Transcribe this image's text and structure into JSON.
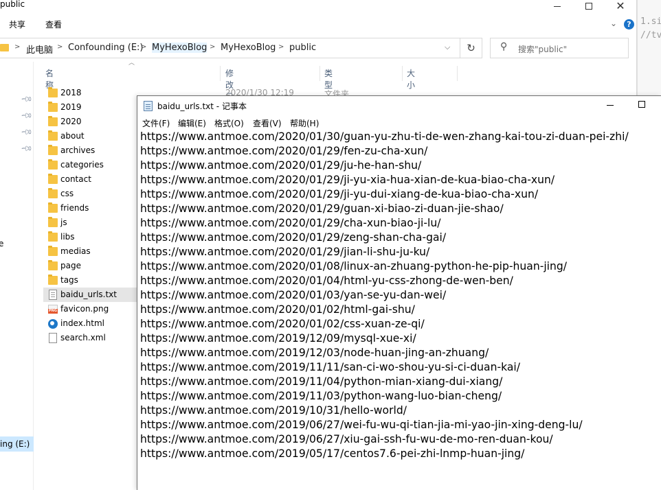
{
  "editor_behind": {
    "line1": "1.si",
    "line2": "//tv"
  },
  "explorer": {
    "title": "public",
    "ribbon": {
      "tab_share": "共享",
      "tab_view": "查看",
      "help_label": "?"
    },
    "breadcrumb": [
      "此电脑",
      "Confounding (E:)",
      "MyHexoBlog",
      "MyHexoBlog",
      "public"
    ],
    "search_placeholder": "搜索\"public\"",
    "columns": {
      "name": "名称",
      "modified": "修改日期",
      "type": "类型",
      "size": "大小"
    },
    "behind_row": {
      "date": "2020/1/30 12:19",
      "type": "文件夹"
    },
    "left_pane": {
      "partial_label": "e",
      "drive_label": "ing (E:)"
    },
    "files": [
      {
        "name": "2018",
        "icon": "folder-icon"
      },
      {
        "name": "2019",
        "icon": "folder-icon"
      },
      {
        "name": "2020",
        "icon": "folder-icon"
      },
      {
        "name": "about",
        "icon": "folder-icon"
      },
      {
        "name": "archives",
        "icon": "folder-icon"
      },
      {
        "name": "categories",
        "icon": "folder-icon"
      },
      {
        "name": "contact",
        "icon": "folder-icon"
      },
      {
        "name": "css",
        "icon": "folder-icon"
      },
      {
        "name": "friends",
        "icon": "folder-icon"
      },
      {
        "name": "js",
        "icon": "folder-icon"
      },
      {
        "name": "libs",
        "icon": "folder-icon"
      },
      {
        "name": "medias",
        "icon": "folder-icon"
      },
      {
        "name": "page",
        "icon": "folder-icon"
      },
      {
        "name": "tags",
        "icon": "folder-icon"
      },
      {
        "name": "baidu_urls.txt",
        "icon": "text-file-icon",
        "selected": true
      },
      {
        "name": "favicon.png",
        "icon": "png-file-icon"
      },
      {
        "name": "index.html",
        "icon": "html-file-icon"
      },
      {
        "name": "search.xml",
        "icon": "xml-file-icon"
      }
    ]
  },
  "notepad": {
    "title": "baidu_urls.txt - 记事本",
    "menu": {
      "file": "文件(F)",
      "edit": "编辑(E)",
      "format": "格式(O)",
      "view": "查看(V)",
      "help": "帮助(H)"
    },
    "lines": [
      "https://www.antmoe.com/2020/01/30/guan-yu-zhu-ti-de-wen-zhang-kai-tou-zi-duan-pei-zhi/",
      "https://www.antmoe.com/2020/01/29/fen-zu-cha-xun/",
      "https://www.antmoe.com/2020/01/29/ju-he-han-shu/",
      "https://www.antmoe.com/2020/01/29/ji-yu-xia-hua-xian-de-kua-biao-cha-xun/",
      "https://www.antmoe.com/2020/01/29/ji-yu-dui-xiang-de-kua-biao-cha-xun/",
      "https://www.antmoe.com/2020/01/29/guan-xi-biao-zi-duan-jie-shao/",
      "https://www.antmoe.com/2020/01/29/cha-xun-biao-ji-lu/",
      "https://www.antmoe.com/2020/01/29/zeng-shan-cha-gai/",
      "https://www.antmoe.com/2020/01/29/jian-li-shu-ju-ku/",
      "https://www.antmoe.com/2020/01/08/linux-an-zhuang-python-he-pip-huan-jing/",
      "https://www.antmoe.com/2020/01/04/html-yu-css-zhong-de-wen-ben/",
      "https://www.antmoe.com/2020/01/03/yan-se-yu-dan-wei/",
      "https://www.antmoe.com/2020/01/02/html-gai-shu/",
      "https://www.antmoe.com/2020/01/02/css-xuan-ze-qi/",
      "https://www.antmoe.com/2019/12/09/mysql-xue-xi/",
      "https://www.antmoe.com/2019/12/03/node-huan-jing-an-zhuang/",
      "https://www.antmoe.com/2019/11/11/san-ci-wo-shou-yu-si-ci-duan-kai/",
      "https://www.antmoe.com/2019/11/04/python-mian-xiang-dui-xiang/",
      "https://www.antmoe.com/2019/11/03/python-wang-luo-bian-cheng/",
      "https://www.antmoe.com/2019/10/31/hello-world/",
      "https://www.antmoe.com/2019/06/27/wei-fu-wu-qi-tian-jia-mi-yao-jin-xing-deng-lu/",
      "https://www.antmoe.com/2019/06/27/xiu-gai-ssh-fu-wu-de-mo-ren-duan-kou/",
      "https://www.antmoe.com/2019/05/17/centos7.6-pei-zhi-lnmp-huan-jing/"
    ]
  },
  "colors": {
    "folder": "#f6c343",
    "selected_row": "#e5e5e5",
    "drive_highlight": "#cce8ff",
    "help_icon": "#1a73c9",
    "column_header_text": "#4c607a"
  }
}
